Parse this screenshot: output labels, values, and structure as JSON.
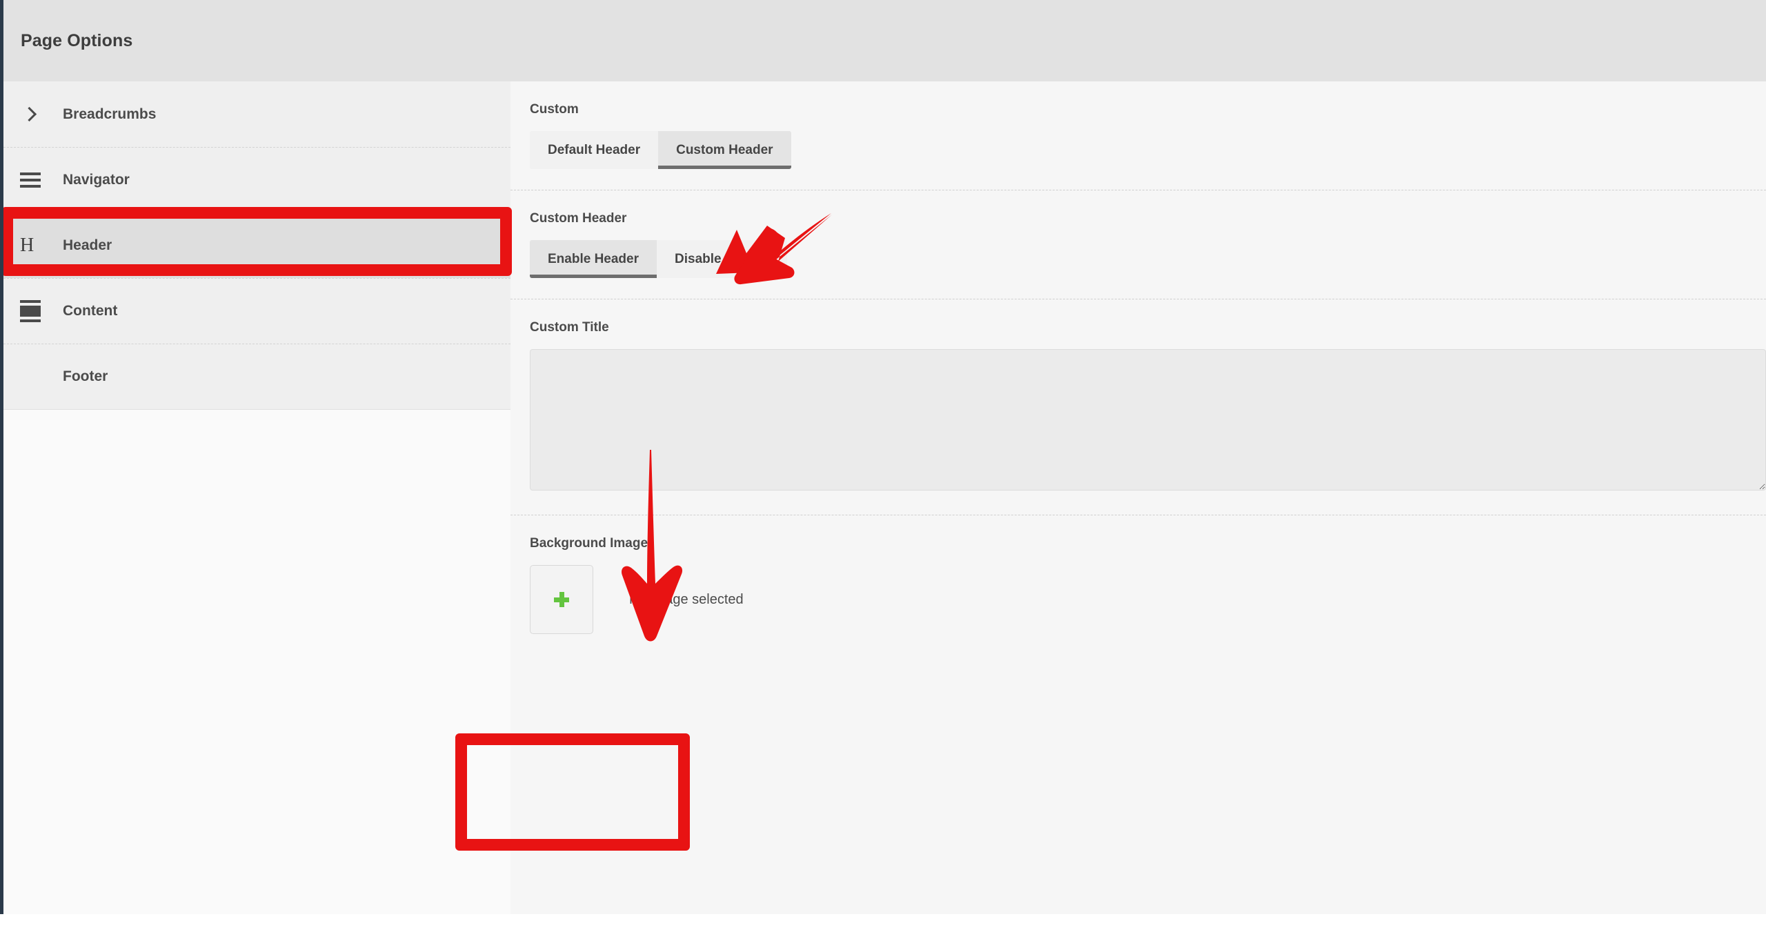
{
  "window": {
    "title": "Page Options"
  },
  "sidebar": {
    "items": [
      {
        "label": "Breadcrumbs",
        "icon": "chevron-right-icon",
        "active": false
      },
      {
        "label": "Navigator",
        "icon": "hamburger-menu-icon",
        "active": false
      },
      {
        "label": "Header",
        "icon": "heading-h-icon",
        "active": true
      },
      {
        "label": "Content",
        "icon": "content-layout-icon",
        "active": false
      },
      {
        "label": "Footer",
        "icon": "none",
        "active": false
      }
    ]
  },
  "panel": {
    "custom_section": {
      "label": "Custom",
      "options": [
        "Default Header",
        "Custom Header"
      ],
      "selected": "Custom Header"
    },
    "custom_header_section": {
      "label": "Custom Header",
      "options": [
        "Enable Header",
        "Disable Header"
      ],
      "selected": "Enable Header"
    },
    "custom_title_section": {
      "label": "Custom Title",
      "value": "",
      "placeholder": ""
    },
    "background_image_section": {
      "label": "Background Image",
      "add_icon": "plus-icon",
      "status": "No image selected"
    }
  },
  "annotations": {
    "highlight_color": "#e81313",
    "boxes": [
      "header-sidebar-item",
      "background-image-field"
    ],
    "arrows": [
      "arrow-to-custom-header-toggle",
      "arrow-to-custom-title-field"
    ]
  },
  "colors": {
    "accent_green": "#63c43f",
    "annotation_red": "#e81313",
    "topbar_bg": "#e2e2e2",
    "sidebar_bg": "#efefef",
    "panel_bg": "#f6f6f6",
    "active_item_bg": "#dedede"
  }
}
